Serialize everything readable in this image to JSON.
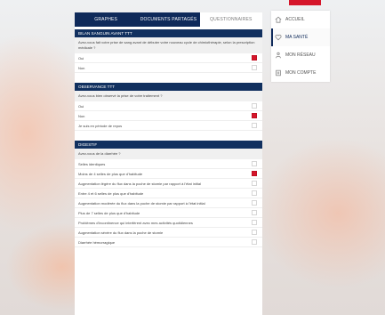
{
  "topbar": {
    "left_text": "",
    "mid_text_1": "",
    "mid_text_2": ""
  },
  "tabs": [
    {
      "label": "GRAPHES"
    },
    {
      "label": "DOCUMENTS PARTAGÉS"
    },
    {
      "label": "QUESTIONNAIRES"
    }
  ],
  "menu": [
    {
      "label": "ACCUEIL",
      "icon": "home-icon"
    },
    {
      "label": "MA SANTÉ",
      "icon": "heart-icon"
    },
    {
      "label": "MON RÉSEAU",
      "icon": "network-icon"
    },
    {
      "label": "MON COMPTE",
      "icon": "account-icon"
    }
  ],
  "sections": {
    "bilan": {
      "title": "BILAN SANGUIN AVANT TTT",
      "question": "Avez-vous fait votre prise de sang avant de débuter votre nouveau cycle de chimiothérapie, selon la prescription médicale ?",
      "options": [
        "Oui",
        "Non"
      ],
      "checked": [
        true,
        false
      ]
    },
    "observance": {
      "title": "OBSERVANCE TTT",
      "question": "Avez-vous bien observé la prise de votre traitement ?",
      "options": [
        "Oui",
        "Non",
        "Je suis en période de repos"
      ],
      "checked": [
        false,
        true,
        false
      ]
    },
    "digestif": {
      "title": "DIGESTIF",
      "question": "Avez-vous de la diarrhée ?",
      "options": [
        "Selles identiques",
        "Moins de 4 selles de plus que d'habitude",
        "Augmentation légère du flux dans la poche de stomie par rapport à l'état initial",
        "Entre 4 et 6 selles de plus que d'habitude",
        "Augmentation modérée du flux dans la poche de stomie par rapport à l'état initial",
        "Plus de 7 selles de plus que d'habitude",
        "Problèmes d'incontinence qui interfèrent avec mes activités quotidiennes",
        "Augmentation sévère du flux dans la poche de stomie",
        "Diarrhée hémorragique"
      ],
      "checked": [
        false,
        true,
        false,
        false,
        false,
        false,
        false,
        false,
        false
      ]
    }
  },
  "colors": {
    "navy": "#0f2a5a",
    "accent_red": "#d5152a"
  }
}
